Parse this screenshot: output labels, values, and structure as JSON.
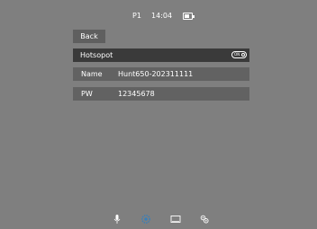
{
  "status": {
    "profile": "P1",
    "time": "14:04",
    "battery_icon": "battery-icon"
  },
  "back_label": "Back",
  "hotspot": {
    "label": "Hotsopot",
    "toggle_state": "ON"
  },
  "name_row": {
    "label": "Name",
    "value": "Hunt650-202311111"
  },
  "pw_row": {
    "label": "PW",
    "value": "12345678"
  },
  "bottom_icons": [
    "microphone-icon",
    "wifi-icon",
    "image-icon",
    "settings-icon"
  ],
  "colors": {
    "background": "#7f7f7f",
    "active_row": "#3a3a3a",
    "field_row": "#626262",
    "wifi_active": "#3a7fb8"
  }
}
